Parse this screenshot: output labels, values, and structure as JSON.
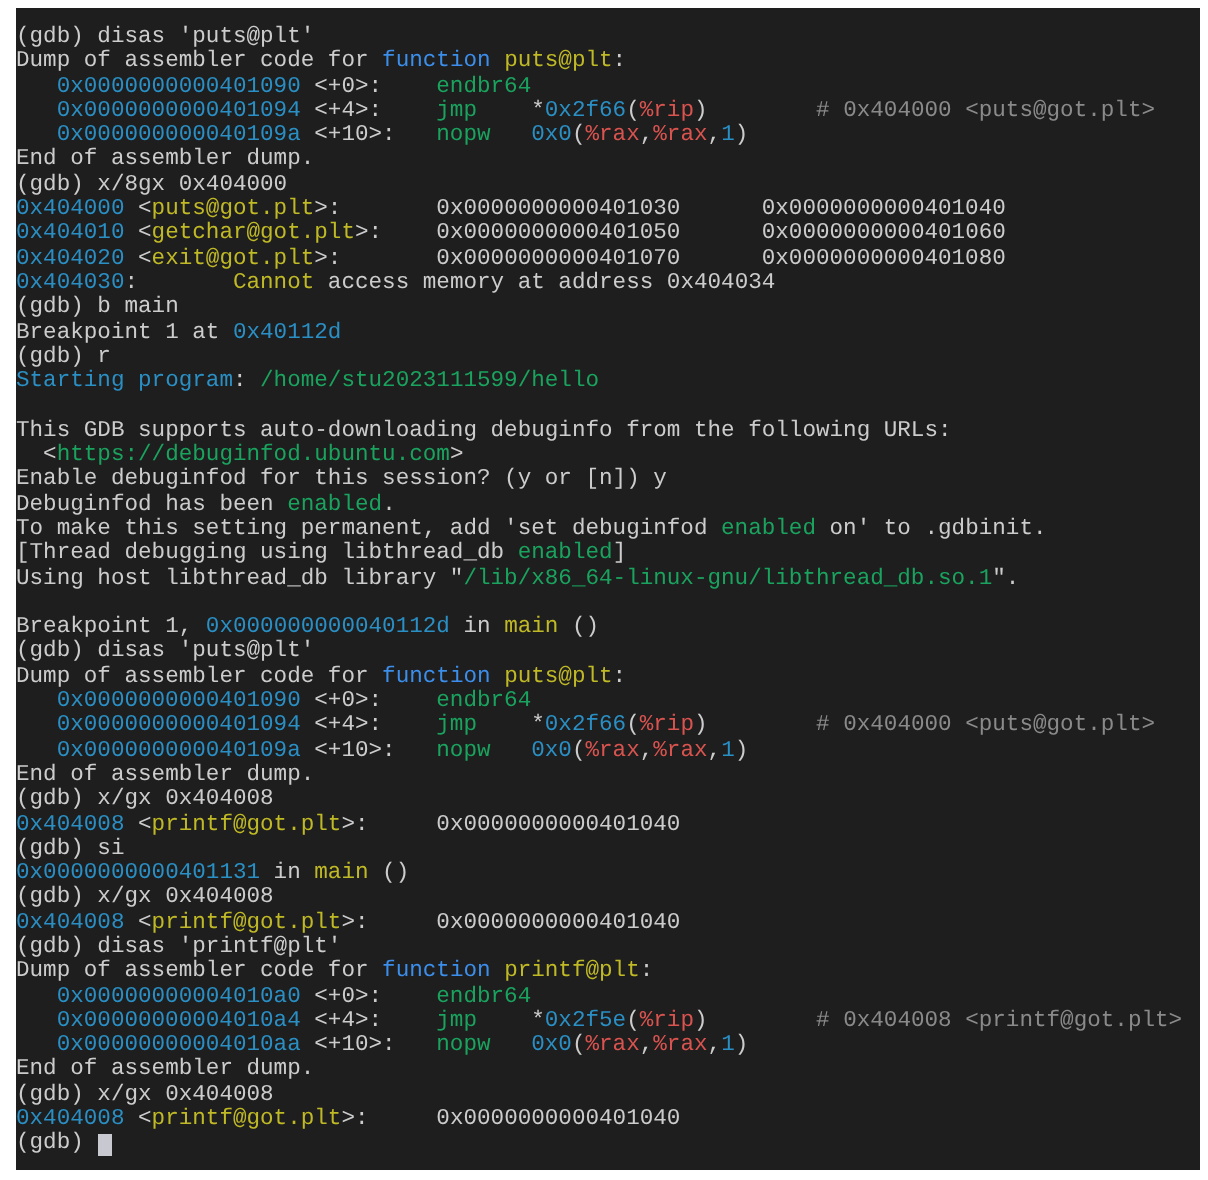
{
  "terminal": {
    "cursor_visible": true,
    "lines": [
      {
        "kind": "text",
        "segments": [
          {
            "kind": "t",
            "text": "(gdb) disas 'puts@plt'"
          }
        ]
      },
      {
        "kind": "text",
        "segments": [
          {
            "kind": "t",
            "text": "Dump of assembler code for "
          },
          {
            "kind": "k",
            "text": "function "
          },
          {
            "kind": "f",
            "text": "puts@plt"
          },
          {
            "kind": "t",
            "text": ":"
          }
        ]
      },
      {
        "kind": "asm",
        "segments": [
          {
            "kind": "a",
            "text": "0x0000000000401090"
          },
          {
            "kind": "t",
            "text": " <+0>:    "
          },
          {
            "kind": "g",
            "text": "endbr64"
          }
        ]
      },
      {
        "kind": "asm",
        "segments": [
          {
            "kind": "a",
            "text": "0x0000000000401094"
          },
          {
            "kind": "t",
            "text": " <+4>:    "
          },
          {
            "kind": "g",
            "text": "jmp"
          },
          {
            "kind": "t",
            "text": "    *"
          },
          {
            "kind": "a",
            "text": "0x2f66"
          },
          {
            "kind": "t",
            "text": "("
          },
          {
            "kind": "r",
            "text": "%rip"
          },
          {
            "kind": "t",
            "text": ")        "
          },
          {
            "kind": "c",
            "text": "# 0x404000 <puts@got.plt>"
          }
        ]
      },
      {
        "kind": "asm",
        "segments": [
          {
            "kind": "a",
            "text": "0x000000000040109a"
          },
          {
            "kind": "t",
            "text": " <+10>:   "
          },
          {
            "kind": "g",
            "text": "nopw   "
          },
          {
            "kind": "a",
            "text": "0x0"
          },
          {
            "kind": "t",
            "text": "("
          },
          {
            "kind": "r",
            "text": "%rax"
          },
          {
            "kind": "t",
            "text": ","
          },
          {
            "kind": "r",
            "text": "%rax"
          },
          {
            "kind": "t",
            "text": ","
          },
          {
            "kind": "a",
            "text": "1"
          },
          {
            "kind": "t",
            "text": ")"
          }
        ]
      },
      {
        "kind": "text",
        "segments": [
          {
            "kind": "t",
            "text": "End of assembler dump."
          }
        ]
      },
      {
        "kind": "text",
        "segments": [
          {
            "kind": "t",
            "text": "(gdb) x/8gx 0x404000"
          }
        ]
      },
      {
        "kind": "text",
        "segments": [
          {
            "kind": "a",
            "text": "0x404000"
          },
          {
            "kind": "t",
            "text": " <"
          },
          {
            "kind": "f",
            "text": "puts@got.plt"
          },
          {
            "kind": "t",
            "text": ">:       0x0000000000401030      0x0000000000401040"
          }
        ]
      },
      {
        "kind": "text",
        "segments": [
          {
            "kind": "a",
            "text": "0x404010"
          },
          {
            "kind": "t",
            "text": " <"
          },
          {
            "kind": "f",
            "text": "getchar@got.plt"
          },
          {
            "kind": "t",
            "text": ">:    0x0000000000401050      0x0000000000401060"
          }
        ]
      },
      {
        "kind": "text",
        "segments": [
          {
            "kind": "a",
            "text": "0x404020"
          },
          {
            "kind": "t",
            "text": " <"
          },
          {
            "kind": "f",
            "text": "exit@got.plt"
          },
          {
            "kind": "t",
            "text": ">:       0x0000000000401070      0x0000000000401080"
          }
        ]
      },
      {
        "kind": "text",
        "segments": [
          {
            "kind": "a",
            "text": "0x404030"
          },
          {
            "kind": "t",
            "text": ":       "
          },
          {
            "kind": "f",
            "text": "Cannot"
          },
          {
            "kind": "t",
            "text": " access memory at address 0x404034"
          }
        ]
      },
      {
        "kind": "text",
        "segments": [
          {
            "kind": "t",
            "text": "(gdb) b main"
          }
        ]
      },
      {
        "kind": "text",
        "segments": [
          {
            "kind": "t",
            "text": "Breakpoint 1 at "
          },
          {
            "kind": "a",
            "text": "0x40112d"
          }
        ]
      },
      {
        "kind": "text",
        "segments": [
          {
            "kind": "t",
            "text": "(gdb) r"
          }
        ]
      },
      {
        "kind": "text",
        "segments": [
          {
            "kind": "a",
            "text": "Starting program"
          },
          {
            "kind": "t",
            "text": ": "
          },
          {
            "kind": "g",
            "text": "/home/stu2023111599/hello"
          }
        ]
      },
      {
        "kind": "blank"
      },
      {
        "kind": "text",
        "segments": [
          {
            "kind": "t",
            "text": "This GDB supports auto-downloading debuginfo from the following URLs:"
          }
        ]
      },
      {
        "kind": "text",
        "segments": [
          {
            "kind": "t",
            "text": "  <"
          },
          {
            "kind": "g",
            "text": "https://debuginfod.ubuntu.com"
          },
          {
            "kind": "t",
            "text": ">"
          }
        ]
      },
      {
        "kind": "text",
        "segments": [
          {
            "kind": "t",
            "text": "Enable debuginfod for this session? (y or [n]) y"
          }
        ]
      },
      {
        "kind": "text",
        "segments": [
          {
            "kind": "t",
            "text": "Debuginfod has been "
          },
          {
            "kind": "g",
            "text": "enabled"
          },
          {
            "kind": "t",
            "text": "."
          }
        ]
      },
      {
        "kind": "text",
        "segments": [
          {
            "kind": "t",
            "text": "To make this setting permanent, add 'set debuginfod "
          },
          {
            "kind": "g",
            "text": "enabled"
          },
          {
            "kind": "t",
            "text": " on' to .gdbinit."
          }
        ]
      },
      {
        "kind": "text",
        "segments": [
          {
            "kind": "t",
            "text": "[Thread debugging using libthread_db "
          },
          {
            "kind": "g",
            "text": "enabled"
          },
          {
            "kind": "t",
            "text": "]"
          }
        ]
      },
      {
        "kind": "text",
        "segments": [
          {
            "kind": "t",
            "text": "Using host libthread_db library \""
          },
          {
            "kind": "g",
            "text": "/lib/x86_64-linux-gnu/libthread_db.so.1"
          },
          {
            "kind": "t",
            "text": "\"."
          }
        ]
      },
      {
        "kind": "blank"
      },
      {
        "kind": "text",
        "segments": [
          {
            "kind": "t",
            "text": "Breakpoint 1, "
          },
          {
            "kind": "a",
            "text": "0x000000000040112d"
          },
          {
            "kind": "t",
            "text": " in "
          },
          {
            "kind": "f",
            "text": "main"
          },
          {
            "kind": "t",
            "text": " ()"
          }
        ]
      },
      {
        "kind": "text",
        "segments": [
          {
            "kind": "t",
            "text": "(gdb) disas 'puts@plt'"
          }
        ]
      },
      {
        "kind": "text",
        "segments": [
          {
            "kind": "t",
            "text": "Dump of assembler code for "
          },
          {
            "kind": "k",
            "text": "function "
          },
          {
            "kind": "f",
            "text": "puts@plt"
          },
          {
            "kind": "t",
            "text": ":"
          }
        ]
      },
      {
        "kind": "asm",
        "segments": [
          {
            "kind": "a",
            "text": "0x0000000000401090"
          },
          {
            "kind": "t",
            "text": " <+0>:    "
          },
          {
            "kind": "g",
            "text": "endbr64"
          }
        ]
      },
      {
        "kind": "asm",
        "segments": [
          {
            "kind": "a",
            "text": "0x0000000000401094"
          },
          {
            "kind": "t",
            "text": " <+4>:    "
          },
          {
            "kind": "g",
            "text": "jmp"
          },
          {
            "kind": "t",
            "text": "    *"
          },
          {
            "kind": "a",
            "text": "0x2f66"
          },
          {
            "kind": "t",
            "text": "("
          },
          {
            "kind": "r",
            "text": "%rip"
          },
          {
            "kind": "t",
            "text": ")        "
          },
          {
            "kind": "c",
            "text": "# 0x404000 <puts@got.plt>"
          }
        ]
      },
      {
        "kind": "asm",
        "segments": [
          {
            "kind": "a",
            "text": "0x000000000040109a"
          },
          {
            "kind": "t",
            "text": " <+10>:   "
          },
          {
            "kind": "g",
            "text": "nopw   "
          },
          {
            "kind": "a",
            "text": "0x0"
          },
          {
            "kind": "t",
            "text": "("
          },
          {
            "kind": "r",
            "text": "%rax"
          },
          {
            "kind": "t",
            "text": ","
          },
          {
            "kind": "r",
            "text": "%rax"
          },
          {
            "kind": "t",
            "text": ","
          },
          {
            "kind": "a",
            "text": "1"
          },
          {
            "kind": "t",
            "text": ")"
          }
        ]
      },
      {
        "kind": "text",
        "segments": [
          {
            "kind": "t",
            "text": "End of assembler dump."
          }
        ]
      },
      {
        "kind": "text",
        "segments": [
          {
            "kind": "t",
            "text": "(gdb) x/gx 0x404008"
          }
        ]
      },
      {
        "kind": "text",
        "segments": [
          {
            "kind": "a",
            "text": "0x404008"
          },
          {
            "kind": "t",
            "text": " <"
          },
          {
            "kind": "f",
            "text": "printf@got.plt"
          },
          {
            "kind": "t",
            "text": ">:     0x0000000000401040"
          }
        ]
      },
      {
        "kind": "text",
        "segments": [
          {
            "kind": "t",
            "text": "(gdb) si"
          }
        ]
      },
      {
        "kind": "text",
        "segments": [
          {
            "kind": "a",
            "text": "0x0000000000401131"
          },
          {
            "kind": "t",
            "text": " in "
          },
          {
            "kind": "f",
            "text": "main"
          },
          {
            "kind": "t",
            "text": " ()"
          }
        ]
      },
      {
        "kind": "text",
        "segments": [
          {
            "kind": "t",
            "text": "(gdb) x/gx 0x404008"
          }
        ]
      },
      {
        "kind": "text",
        "segments": [
          {
            "kind": "a",
            "text": "0x404008"
          },
          {
            "kind": "t",
            "text": " <"
          },
          {
            "kind": "f",
            "text": "printf@got.plt"
          },
          {
            "kind": "t",
            "text": ">:     0x0000000000401040"
          }
        ]
      },
      {
        "kind": "text",
        "segments": [
          {
            "kind": "t",
            "text": "(gdb) disas 'printf@plt'"
          }
        ]
      },
      {
        "kind": "text",
        "segments": [
          {
            "kind": "t",
            "text": "Dump of assembler code for "
          },
          {
            "kind": "k",
            "text": "function "
          },
          {
            "kind": "f",
            "text": "printf@plt"
          },
          {
            "kind": "t",
            "text": ":"
          }
        ]
      },
      {
        "kind": "asm",
        "segments": [
          {
            "kind": "a",
            "text": "0x00000000004010a0"
          },
          {
            "kind": "t",
            "text": " <+0>:    "
          },
          {
            "kind": "g",
            "text": "endbr64"
          }
        ]
      },
      {
        "kind": "asm",
        "segments": [
          {
            "kind": "a",
            "text": "0x00000000004010a4"
          },
          {
            "kind": "t",
            "text": " <+4>:    "
          },
          {
            "kind": "g",
            "text": "jmp"
          },
          {
            "kind": "t",
            "text": "    *"
          },
          {
            "kind": "a",
            "text": "0x2f5e"
          },
          {
            "kind": "t",
            "text": "("
          },
          {
            "kind": "r",
            "text": "%rip"
          },
          {
            "kind": "t",
            "text": ")        "
          },
          {
            "kind": "c",
            "text": "# 0x404008 <printf@got.plt>"
          }
        ]
      },
      {
        "kind": "asm",
        "segments": [
          {
            "kind": "a",
            "text": "0x00000000004010aa"
          },
          {
            "kind": "t",
            "text": " <+10>:   "
          },
          {
            "kind": "g",
            "text": "nopw   "
          },
          {
            "kind": "a",
            "text": "0x0"
          },
          {
            "kind": "t",
            "text": "("
          },
          {
            "kind": "r",
            "text": "%rax"
          },
          {
            "kind": "t",
            "text": ","
          },
          {
            "kind": "r",
            "text": "%rax"
          },
          {
            "kind": "t",
            "text": ","
          },
          {
            "kind": "a",
            "text": "1"
          },
          {
            "kind": "t",
            "text": ")"
          }
        ]
      },
      {
        "kind": "text",
        "segments": [
          {
            "kind": "t",
            "text": "End of assembler dump."
          }
        ]
      },
      {
        "kind": "text",
        "segments": [
          {
            "kind": "t",
            "text": "(gdb) x/gx 0x404008"
          }
        ]
      },
      {
        "kind": "text",
        "segments": [
          {
            "kind": "a",
            "text": "0x404008"
          },
          {
            "kind": "t",
            "text": " <"
          },
          {
            "kind": "f",
            "text": "printf@got.plt"
          },
          {
            "kind": "t",
            "text": ">:     0x0000000000401040"
          }
        ]
      },
      {
        "kind": "text",
        "segments": [
          {
            "kind": "t",
            "text": "(gdb)"
          }
        ]
      }
    ]
  }
}
